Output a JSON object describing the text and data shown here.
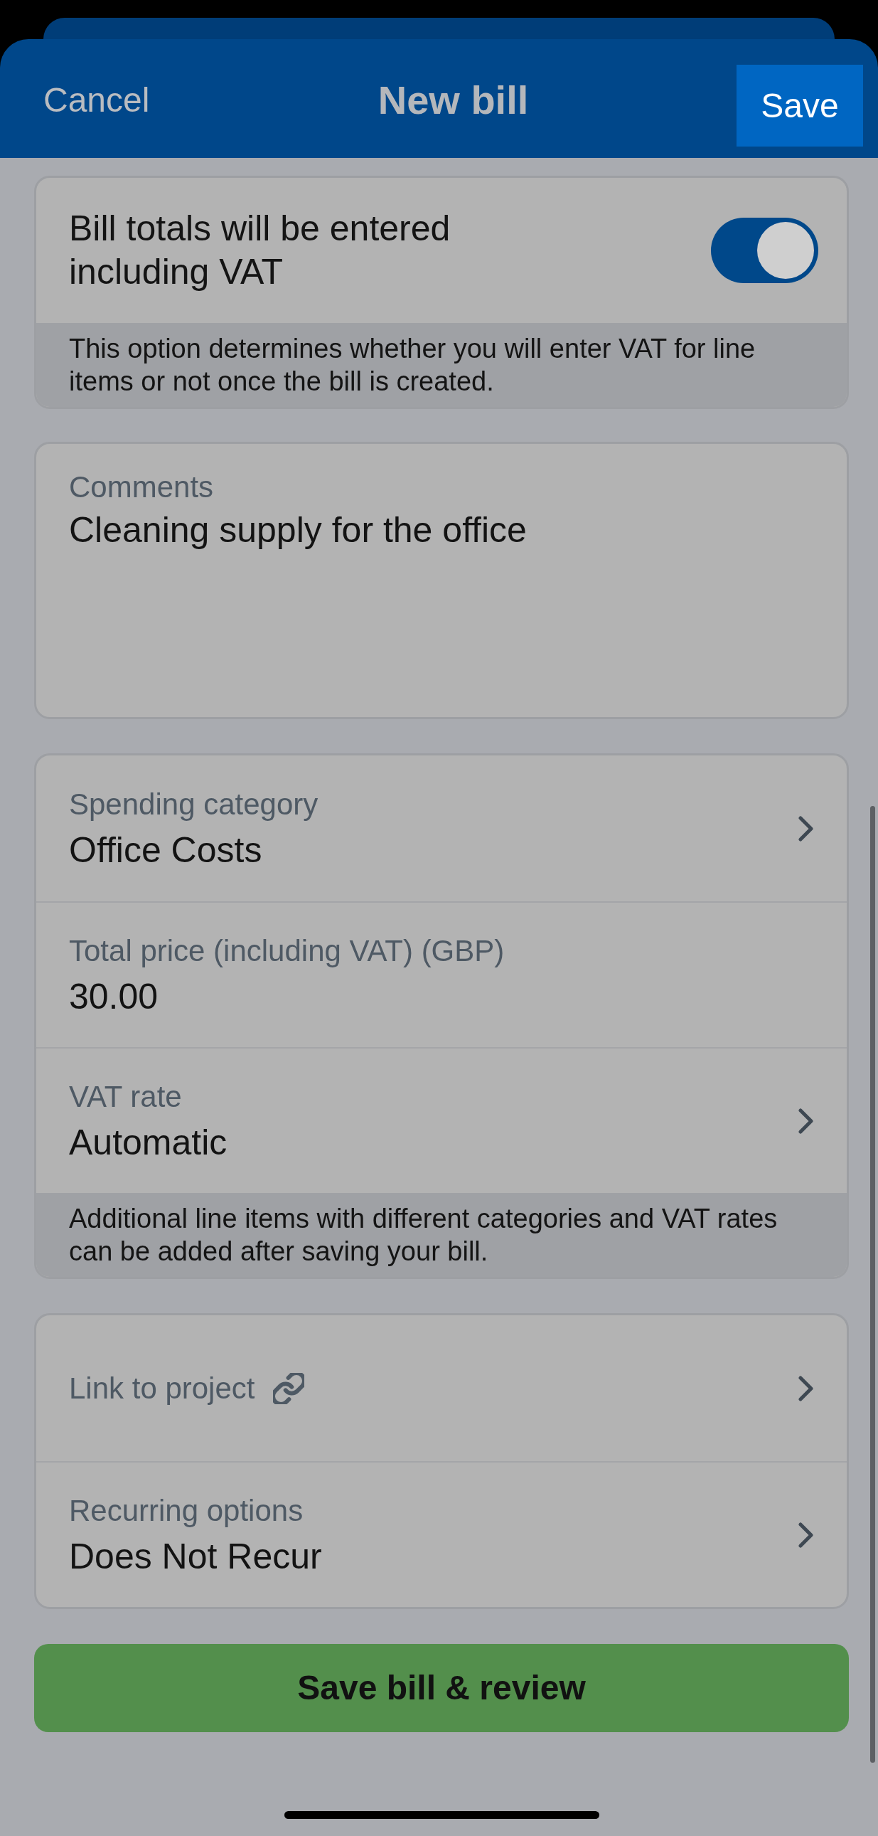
{
  "header": {
    "cancel": "Cancel",
    "title": "New bill",
    "save": "Save"
  },
  "vat_card": {
    "label": "Bill totals will be entered including VAT",
    "on": true,
    "note": "This option determines whether you will enter VAT for line items or not once the bill is created."
  },
  "comments": {
    "label": "Comments",
    "value": "Cleaning supply for the office"
  },
  "line_item": {
    "rows": [
      {
        "kind": "select",
        "label": "Spending category",
        "value": "Office Costs"
      },
      {
        "kind": "input",
        "label": "Total price (including VAT) (GBP)",
        "value": "30.00"
      },
      {
        "kind": "select",
        "label": "VAT rate",
        "value": "Automatic"
      }
    ],
    "note": "Additional line items with different categories and VAT rates can be added after saving your bill."
  },
  "options": {
    "rows": [
      {
        "kind": "link",
        "label": "Link to project"
      },
      {
        "kind": "select",
        "label": "Recurring options",
        "value": "Does Not Recur"
      }
    ]
  },
  "submit_button": "Save bill & review"
}
